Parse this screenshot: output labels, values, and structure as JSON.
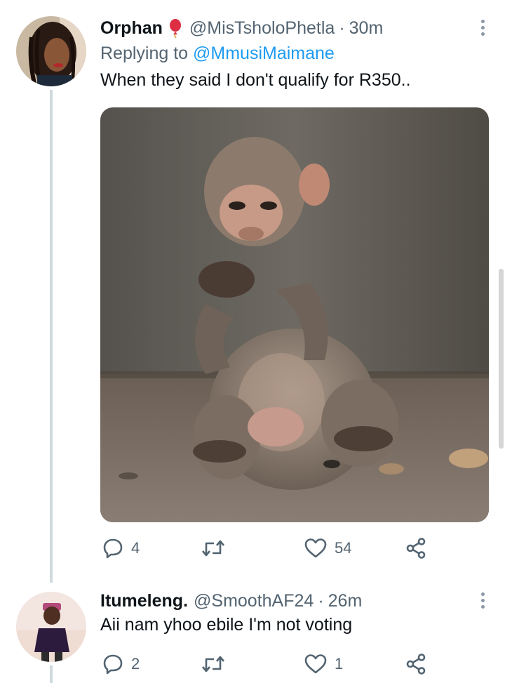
{
  "tweets": [
    {
      "name": "Orphan",
      "handle": "@MisTsholoPhetla",
      "separator": "·",
      "time": "30m",
      "replying_prefix": "Replying to ",
      "replying_to": "@MmusiMaimane",
      "text": "When they said I don't qualify for R350..",
      "name_emoji": "balloon-emoji",
      "has_media": true,
      "actions": {
        "reply": "4",
        "retweet": "",
        "like": "54"
      }
    },
    {
      "name": "Itumeleng.",
      "handle": "@SmoothAF24",
      "separator": "·",
      "time": "26m",
      "text": "Aii nam yhoo ebile I'm not voting",
      "has_media": false,
      "actions": {
        "reply": "2",
        "retweet": "",
        "like": "1"
      }
    }
  ],
  "colors": {
    "text": "#0f1419",
    "secondary": "#536471",
    "link": "#1d9bf0",
    "thread_line": "#cfd9de"
  }
}
